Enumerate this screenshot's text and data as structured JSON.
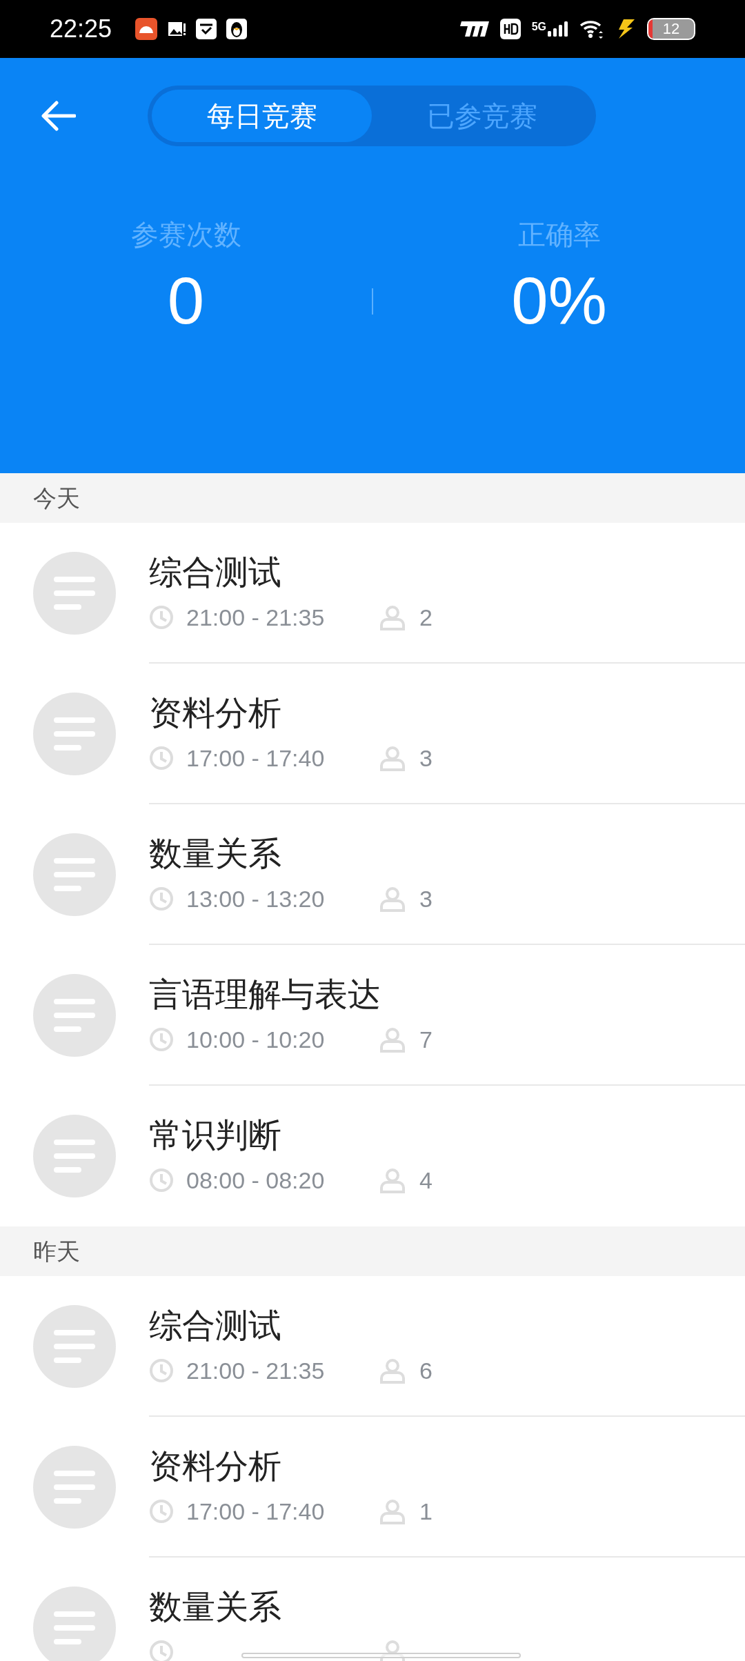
{
  "status_bar": {
    "time": "22:25",
    "network": "5G",
    "battery": "12"
  },
  "tabs": [
    {
      "label": "每日竞赛",
      "selected": true
    },
    {
      "label": "已参竞赛",
      "selected": false
    }
  ],
  "stats": [
    {
      "label": "参赛次数",
      "value": "0"
    },
    {
      "label": "正确率",
      "value": "0%"
    }
  ],
  "sections": [
    {
      "title": "今天",
      "items": [
        {
          "title": "综合测试",
          "time": "21:00 - 21:35",
          "participants": "2"
        },
        {
          "title": "资料分析",
          "time": "17:00 - 17:40",
          "participants": "3"
        },
        {
          "title": "数量关系",
          "time": "13:00 - 13:20",
          "participants": "3"
        },
        {
          "title": "言语理解与表达",
          "time": "10:00 - 10:20",
          "participants": "7"
        },
        {
          "title": "常识判断",
          "time": "08:00 - 08:20",
          "participants": "4"
        }
      ]
    },
    {
      "title": "昨天",
      "items": [
        {
          "title": "综合测试",
          "time": "21:00 - 21:35",
          "participants": "6"
        },
        {
          "title": "资料分析",
          "time": "17:00 - 17:40",
          "participants": "1"
        },
        {
          "title": "数量关系"
        }
      ]
    }
  ]
}
